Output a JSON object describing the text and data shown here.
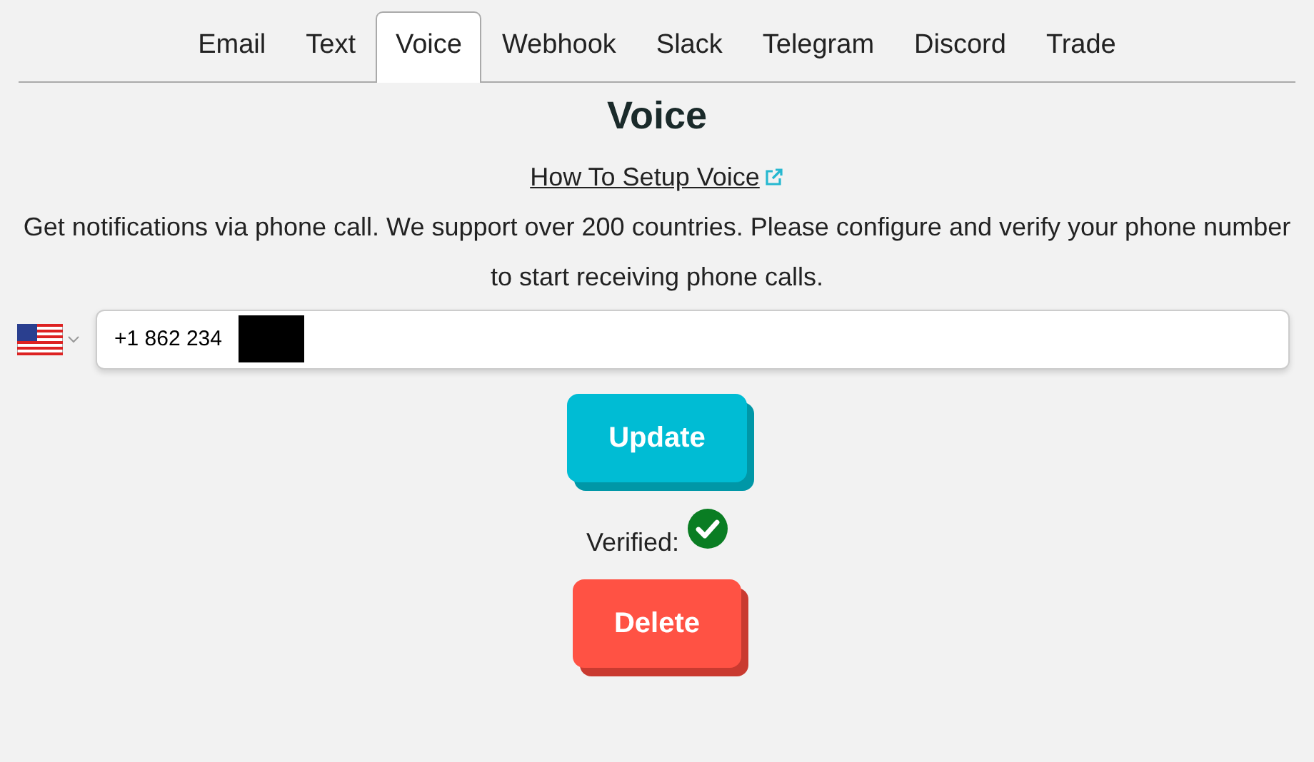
{
  "tabs": [
    {
      "label": "Email",
      "selected": false
    },
    {
      "label": "Text",
      "selected": false
    },
    {
      "label": "Voice",
      "selected": true
    },
    {
      "label": "Webhook",
      "selected": false
    },
    {
      "label": "Slack",
      "selected": false
    },
    {
      "label": "Telegram",
      "selected": false
    },
    {
      "label": "Discord",
      "selected": false
    },
    {
      "label": "Trade",
      "selected": false
    }
  ],
  "heading": "Voice",
  "setup_link": "How To Setup Voice",
  "description": "Get notifications via phone call. We support over 200 countries. Please configure and verify your phone number to start receiving phone calls.",
  "phone": {
    "value": "+1 862 234"
  },
  "update_button": "Update",
  "verified": {
    "label": "Verified:",
    "verified": true
  },
  "delete_button": "Delete"
}
